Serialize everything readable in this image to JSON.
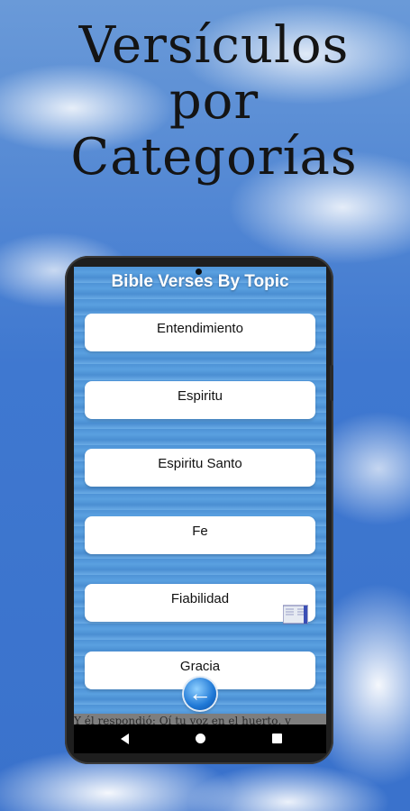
{
  "promo": {
    "headline_lines": [
      "Versículos",
      "por",
      "Categorías"
    ]
  },
  "app": {
    "title": "Bible Verses By Topic",
    "topics": [
      "Entendimiento",
      "Espiritu",
      "Espiritu Santo",
      "Fe",
      "Fiabilidad",
      "Gracia"
    ],
    "verse_preview": "Y él respondió: Oí tu voz en el huerto, y"
  },
  "icons": {
    "back": "back-arrow-icon",
    "book": "book-icon",
    "nav": [
      "nav-back-icon",
      "nav-home-icon",
      "nav-recents-icon"
    ]
  },
  "colors": {
    "sky": "#3f78d0",
    "app_background": "#5aa0e0",
    "button_background": "#ffffff",
    "title_text": "#ffffff"
  }
}
